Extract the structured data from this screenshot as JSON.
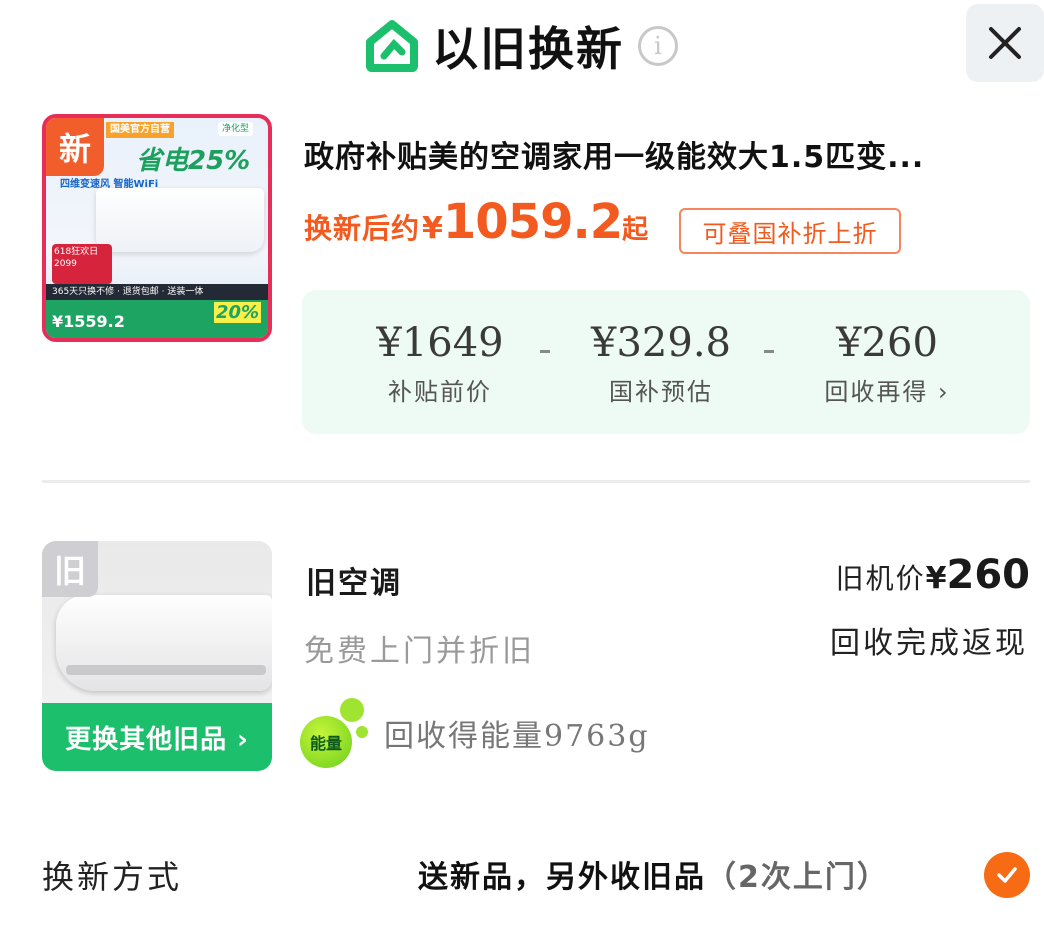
{
  "header": {
    "title": "以旧换新",
    "info_glyph": "i",
    "close_glyph": "×"
  },
  "new_product": {
    "badge": "新",
    "image_texts": {
      "top_tag": "国美官方自营",
      "green_tag": "净化型",
      "slogan": "四维变速风 智能WiFi",
      "headline": "省电25%",
      "promo": "618狂欢日",
      "promo_price": "2099",
      "strip": "365天只换不修 · 退货包邮 · 送装一体",
      "price": "¥1559.2",
      "pct": "20%"
    },
    "title": "政府补贴美的空调家用一级能效大1.5匹变...",
    "price_prefix": "换新后约",
    "price_currency": "¥",
    "price_value": "1059.2",
    "price_suffix": "起",
    "stack_tag": "可叠国补折上折",
    "calc": {
      "before_price": "¥1649",
      "before_label": "补贴前价",
      "subsidy": "¥329.8",
      "subsidy_label": "国补预估",
      "recycle": "¥260",
      "recycle_label": "回收再得 ›"
    }
  },
  "old_item": {
    "badge": "旧",
    "swap_button": "更换其他旧品 ›",
    "title": "旧空调",
    "subtitle": "免费上门并折旧",
    "energy_icon_text": "能量",
    "energy_text": "回收得能量9763g",
    "price_label": "旧机价",
    "price_currency": "¥",
    "price_value": "260",
    "cashback": "回收完成返现"
  },
  "method": {
    "label": "换新方式",
    "value": "送新品，另外收旧品",
    "paren": "（2次上门）",
    "selected": true
  },
  "colors": {
    "accent_orange": "#f25a1f",
    "brand_green": "#1cbf6b",
    "calc_bg": "#eefaf4"
  }
}
